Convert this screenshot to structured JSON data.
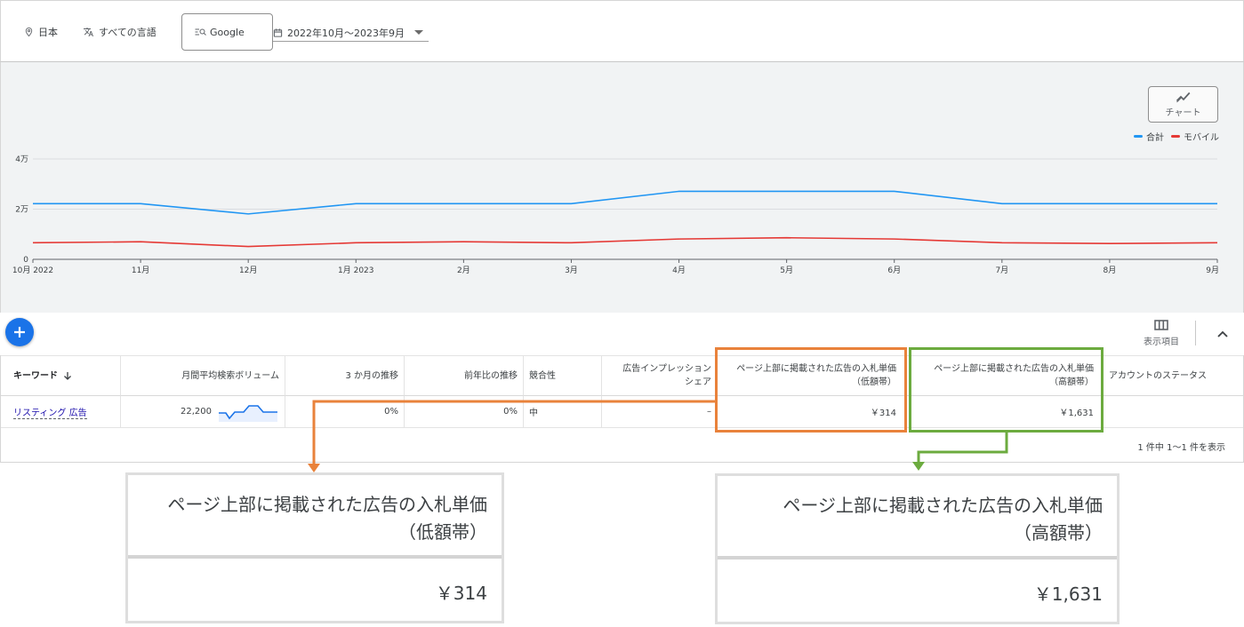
{
  "filters": {
    "location": "日本",
    "language": "すべての言語",
    "search_engine": "Google",
    "date_range": "2022年10月～2023年9月"
  },
  "chart_toggle": {
    "label": "チャート",
    "icon": "trend-line-icon"
  },
  "legend": {
    "total": "合計",
    "mobile": "モバイル"
  },
  "colors": {
    "total": "#2196f3",
    "mobile": "#e53935",
    "accent": "#1a73e8",
    "highlight_low": "#e9823b",
    "highlight_high": "#6cab3f"
  },
  "chart_data": {
    "type": "line",
    "x": [
      "10月 2022",
      "11月",
      "12月",
      "1月 2023",
      "2月",
      "3月",
      "4月",
      "5月",
      "6月",
      "7月",
      "8月",
      "9月"
    ],
    "ylim": [
      0,
      40000
    ],
    "yticks": [
      "0",
      "2万",
      "4万"
    ],
    "series": [
      {
        "name": "合計",
        "values": [
          22200,
          22200,
          18100,
          22200,
          22200,
          22200,
          27100,
          27100,
          27100,
          22200,
          22200,
          22200
        ]
      },
      {
        "name": "モバイル",
        "values": [
          6600,
          7000,
          5100,
          6600,
          7000,
          6600,
          8100,
          8600,
          8100,
          6600,
          6300,
          6600
        ]
      }
    ],
    "grid": true,
    "legend_position": "top-right"
  },
  "toolbar": {
    "columns_label": "表示項目"
  },
  "table": {
    "headers": {
      "keyword": "キーワード",
      "volume": "月間平均検索ボリューム",
      "three_month": "3 か月の推移",
      "yoy": "前年比の推移",
      "competition": "競合性",
      "impression_share_1": "広告インプレッション",
      "impression_share_2": "シェア",
      "bid_low_1": "ページ上部に掲載された広告の入札単価",
      "bid_low_2": "（低額帯）",
      "bid_high_1": "ページ上部に掲載された広告の入札単価",
      "bid_high_2": "（高額帯）",
      "account_status": "アカウントのステータス"
    },
    "rows": [
      {
        "keyword": "リスティング 広告",
        "volume": "22,200",
        "three_month": "0%",
        "yoy": "0%",
        "competition": "中",
        "impression_share": "–",
        "bid_low": "￥314",
        "bid_high": "￥1,631",
        "account_status": ""
      }
    ],
    "pagination": "1 件中 1～1 件を表示"
  },
  "zoom": {
    "low": {
      "line1": "ページ上部に掲載された広告の入札単価",
      "line2": "（低額帯）",
      "value": "￥314"
    },
    "high": {
      "line1": "ページ上部に掲載された広告の入札単価",
      "line2": "（高額帯）",
      "value": "￥1,631"
    }
  }
}
